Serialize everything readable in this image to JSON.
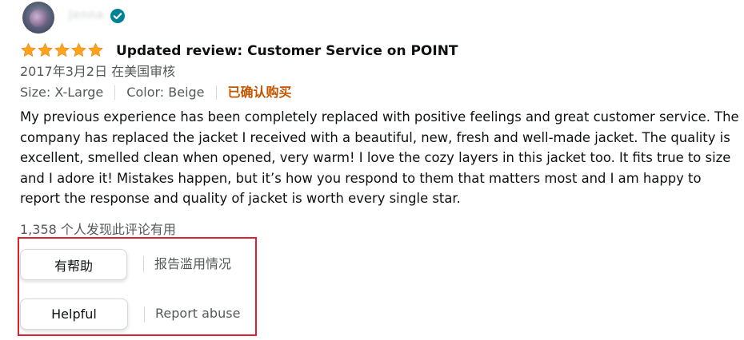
{
  "reviewer": {
    "name": "Jenna"
  },
  "review": {
    "rating": 5,
    "rating_max": 5,
    "title": "Updated review: Customer Service on POINT",
    "date_location": "2017年3月2日 在美国审核",
    "size": "Size: X-Large",
    "color": "Color: Beige",
    "verified_purchase": "已确认购买",
    "body": "My previous experience has been completely replaced with positive feelings and great customer service. The company has replaced the jacket I received with a beautiful, new, fresh and well-made jacket. The quality is excellent, smelled clean when opened, very warm! I love the cozy layers in this jacket too. It fits true to size and I adore it! Mistakes happen, but it’s how you respond to them that matters most and I am happy to report the response and quality of jacket is worth every single star.",
    "helpful_count": "1,358 个人发现此评论有用"
  },
  "actions_zh": {
    "helpful_label": "有帮助",
    "report_label": "报告滥用情况"
  },
  "actions_en": {
    "helpful_label": "Helpful",
    "report_label": "Report abuse"
  },
  "colors": {
    "star": "#ffa41c",
    "verified_badge": "#008296",
    "verified_purchase": "#c45500",
    "highlight_box": "#e0202e"
  },
  "icons": {
    "star": "star-icon",
    "verified": "verified-check-icon"
  }
}
